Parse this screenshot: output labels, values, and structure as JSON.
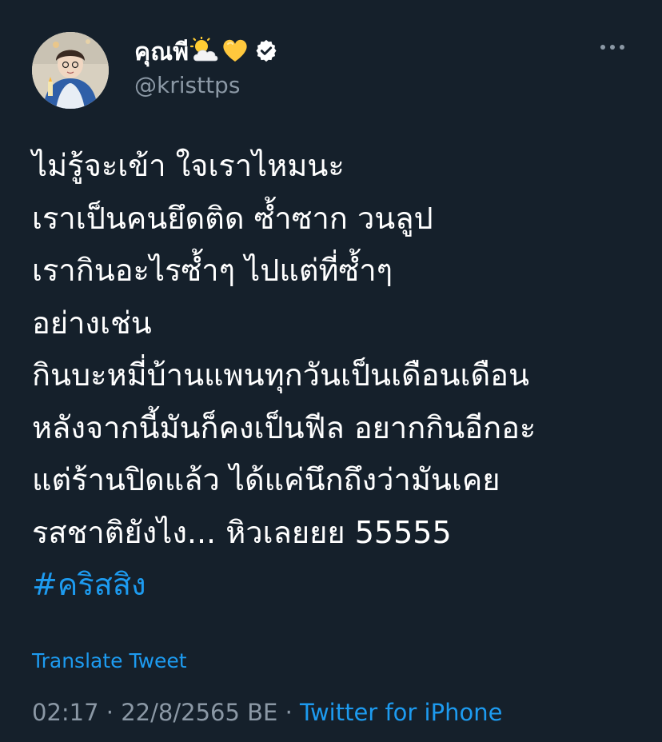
{
  "author": {
    "display_name": "คุณพี",
    "emojis": [
      "sun-behind-cloud",
      "yellow-heart"
    ],
    "verified": true,
    "handle": "@kristtps"
  },
  "tweet": {
    "lines": [
      "ไม่รู้จะเข้า ใจเราไหมนะ",
      "เราเป็นคนยึดติด ซ้ำซาก วนลูป",
      "เรากินอะไรซ้ำๆ ไปแต่ที่ซ้ำๆ",
      "อย่างเช่น",
      "กินบะหมี่บ้านแพนทุกวันเป็นเดือนเดือน",
      "หลังจากนี้มันก็คงเป็นฟีล อยากกินอีกอะ",
      "แต่ร้านปิดแล้ว ได้แค่นึกถึงว่ามันเคย",
      "รสชาติยังไง... หิวเลยยย 55555"
    ],
    "hashtag": "#คริสสิง"
  },
  "translate_label": "Translate Tweet",
  "meta": {
    "time": "02:17",
    "separator": " · ",
    "date": "22/8/2565 BE",
    "source": "Twitter for iPhone"
  },
  "colors": {
    "background": "#15202b",
    "text": "#ffffff",
    "secondary": "#8b98a5",
    "accent": "#1d9bf0"
  }
}
